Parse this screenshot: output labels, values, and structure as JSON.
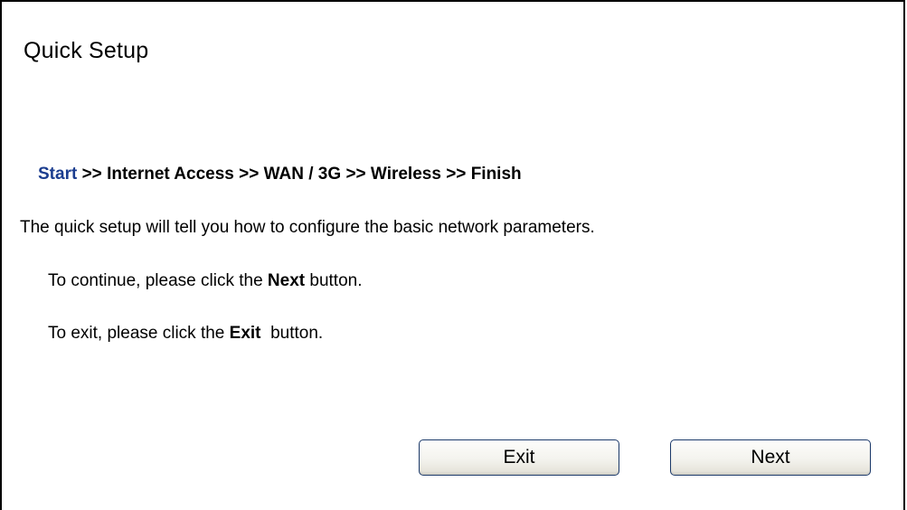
{
  "page": {
    "title": "Quick Setup"
  },
  "steps": {
    "current": "Start",
    "separator": ">>",
    "items": [
      "Internet Access",
      "WAN / 3G",
      "Wireless",
      "Finish"
    ],
    "current_color": "#1b3d8f"
  },
  "content": {
    "description": "The quick setup will tell you how to configure the basic network parameters.",
    "continue_prefix": "To continue, please click the",
    "continue_keyword": "Next",
    "continue_suffix": "button.",
    "exit_prefix": "To exit, please click the",
    "exit_keyword": "Exit",
    "exit_suffix": "button."
  },
  "buttons": {
    "exit_label": "Exit",
    "next_label": "Next"
  }
}
